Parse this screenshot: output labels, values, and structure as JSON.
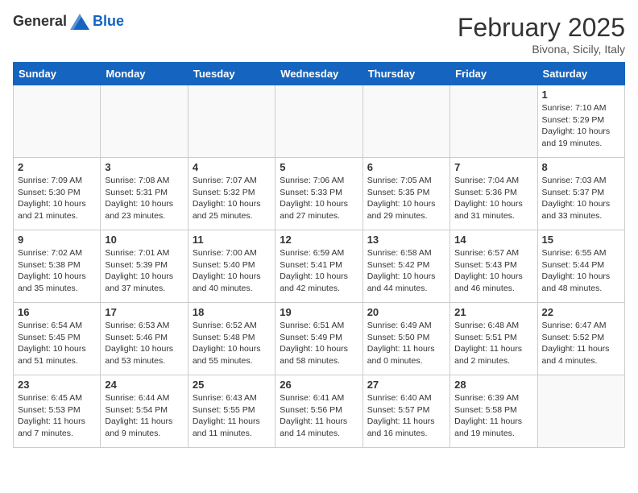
{
  "header": {
    "logo_general": "General",
    "logo_blue": "Blue",
    "month_title": "February 2025",
    "location": "Bivona, Sicily, Italy"
  },
  "days_of_week": [
    "Sunday",
    "Monday",
    "Tuesday",
    "Wednesday",
    "Thursday",
    "Friday",
    "Saturday"
  ],
  "weeks": [
    [
      {
        "day": "",
        "info": ""
      },
      {
        "day": "",
        "info": ""
      },
      {
        "day": "",
        "info": ""
      },
      {
        "day": "",
        "info": ""
      },
      {
        "day": "",
        "info": ""
      },
      {
        "day": "",
        "info": ""
      },
      {
        "day": "1",
        "info": "Sunrise: 7:10 AM\nSunset: 5:29 PM\nDaylight: 10 hours\nand 19 minutes."
      }
    ],
    [
      {
        "day": "2",
        "info": "Sunrise: 7:09 AM\nSunset: 5:30 PM\nDaylight: 10 hours\nand 21 minutes."
      },
      {
        "day": "3",
        "info": "Sunrise: 7:08 AM\nSunset: 5:31 PM\nDaylight: 10 hours\nand 23 minutes."
      },
      {
        "day": "4",
        "info": "Sunrise: 7:07 AM\nSunset: 5:32 PM\nDaylight: 10 hours\nand 25 minutes."
      },
      {
        "day": "5",
        "info": "Sunrise: 7:06 AM\nSunset: 5:33 PM\nDaylight: 10 hours\nand 27 minutes."
      },
      {
        "day": "6",
        "info": "Sunrise: 7:05 AM\nSunset: 5:35 PM\nDaylight: 10 hours\nand 29 minutes."
      },
      {
        "day": "7",
        "info": "Sunrise: 7:04 AM\nSunset: 5:36 PM\nDaylight: 10 hours\nand 31 minutes."
      },
      {
        "day": "8",
        "info": "Sunrise: 7:03 AM\nSunset: 5:37 PM\nDaylight: 10 hours\nand 33 minutes."
      }
    ],
    [
      {
        "day": "9",
        "info": "Sunrise: 7:02 AM\nSunset: 5:38 PM\nDaylight: 10 hours\nand 35 minutes."
      },
      {
        "day": "10",
        "info": "Sunrise: 7:01 AM\nSunset: 5:39 PM\nDaylight: 10 hours\nand 37 minutes."
      },
      {
        "day": "11",
        "info": "Sunrise: 7:00 AM\nSunset: 5:40 PM\nDaylight: 10 hours\nand 40 minutes."
      },
      {
        "day": "12",
        "info": "Sunrise: 6:59 AM\nSunset: 5:41 PM\nDaylight: 10 hours\nand 42 minutes."
      },
      {
        "day": "13",
        "info": "Sunrise: 6:58 AM\nSunset: 5:42 PM\nDaylight: 10 hours\nand 44 minutes."
      },
      {
        "day": "14",
        "info": "Sunrise: 6:57 AM\nSunset: 5:43 PM\nDaylight: 10 hours\nand 46 minutes."
      },
      {
        "day": "15",
        "info": "Sunrise: 6:55 AM\nSunset: 5:44 PM\nDaylight: 10 hours\nand 48 minutes."
      }
    ],
    [
      {
        "day": "16",
        "info": "Sunrise: 6:54 AM\nSunset: 5:45 PM\nDaylight: 10 hours\nand 51 minutes."
      },
      {
        "day": "17",
        "info": "Sunrise: 6:53 AM\nSunset: 5:46 PM\nDaylight: 10 hours\nand 53 minutes."
      },
      {
        "day": "18",
        "info": "Sunrise: 6:52 AM\nSunset: 5:48 PM\nDaylight: 10 hours\nand 55 minutes."
      },
      {
        "day": "19",
        "info": "Sunrise: 6:51 AM\nSunset: 5:49 PM\nDaylight: 10 hours\nand 58 minutes."
      },
      {
        "day": "20",
        "info": "Sunrise: 6:49 AM\nSunset: 5:50 PM\nDaylight: 11 hours\nand 0 minutes."
      },
      {
        "day": "21",
        "info": "Sunrise: 6:48 AM\nSunset: 5:51 PM\nDaylight: 11 hours\nand 2 minutes."
      },
      {
        "day": "22",
        "info": "Sunrise: 6:47 AM\nSunset: 5:52 PM\nDaylight: 11 hours\nand 4 minutes."
      }
    ],
    [
      {
        "day": "23",
        "info": "Sunrise: 6:45 AM\nSunset: 5:53 PM\nDaylight: 11 hours\nand 7 minutes."
      },
      {
        "day": "24",
        "info": "Sunrise: 6:44 AM\nSunset: 5:54 PM\nDaylight: 11 hours\nand 9 minutes."
      },
      {
        "day": "25",
        "info": "Sunrise: 6:43 AM\nSunset: 5:55 PM\nDaylight: 11 hours\nand 11 minutes."
      },
      {
        "day": "26",
        "info": "Sunrise: 6:41 AM\nSunset: 5:56 PM\nDaylight: 11 hours\nand 14 minutes."
      },
      {
        "day": "27",
        "info": "Sunrise: 6:40 AM\nSunset: 5:57 PM\nDaylight: 11 hours\nand 16 minutes."
      },
      {
        "day": "28",
        "info": "Sunrise: 6:39 AM\nSunset: 5:58 PM\nDaylight: 11 hours\nand 19 minutes."
      },
      {
        "day": "",
        "info": ""
      }
    ]
  ]
}
